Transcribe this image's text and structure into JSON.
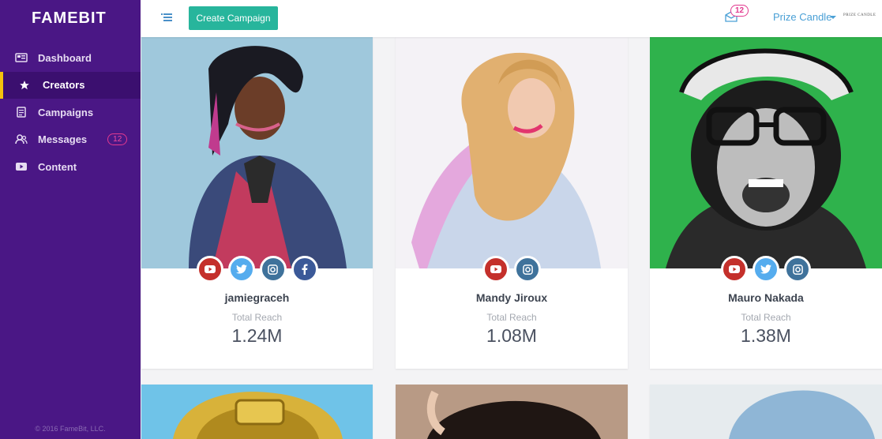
{
  "brand": "FAMEBIT",
  "sidebar": {
    "items": [
      {
        "label": "Dashboard",
        "icon": "dashboard-icon"
      },
      {
        "label": "Creators",
        "icon": "star-icon"
      },
      {
        "label": "Campaigns",
        "icon": "document-icon"
      },
      {
        "label": "Messages",
        "icon": "users-icon",
        "badge": "12"
      },
      {
        "label": "Content",
        "icon": "video-icon"
      }
    ],
    "copyright": "© 2016 FameBit, LLC."
  },
  "topbar": {
    "create_label": "Create Campaign",
    "notifications": "12",
    "user_name": "Prize Candle",
    "user_logo": "PRIZE CANDLE"
  },
  "creators": [
    {
      "name": "jamiegraceh",
      "reach_label": "Total Reach",
      "reach": "1.24M",
      "networks": [
        "youtube",
        "twitter",
        "instagram",
        "facebook"
      ]
    },
    {
      "name": "Mandy Jiroux",
      "reach_label": "Total Reach",
      "reach": "1.08M",
      "networks": [
        "youtube",
        "instagram"
      ]
    },
    {
      "name": "Mauro Nakada",
      "reach_label": "Total Reach",
      "reach": "1.38M",
      "networks": [
        "youtube",
        "twitter",
        "instagram"
      ]
    }
  ],
  "colors": {
    "sidebar": "#4a1785",
    "active_indicator": "#f4c20d",
    "accent": "#27b59c",
    "badge": "#e2398f",
    "link": "#4aa0d6"
  }
}
